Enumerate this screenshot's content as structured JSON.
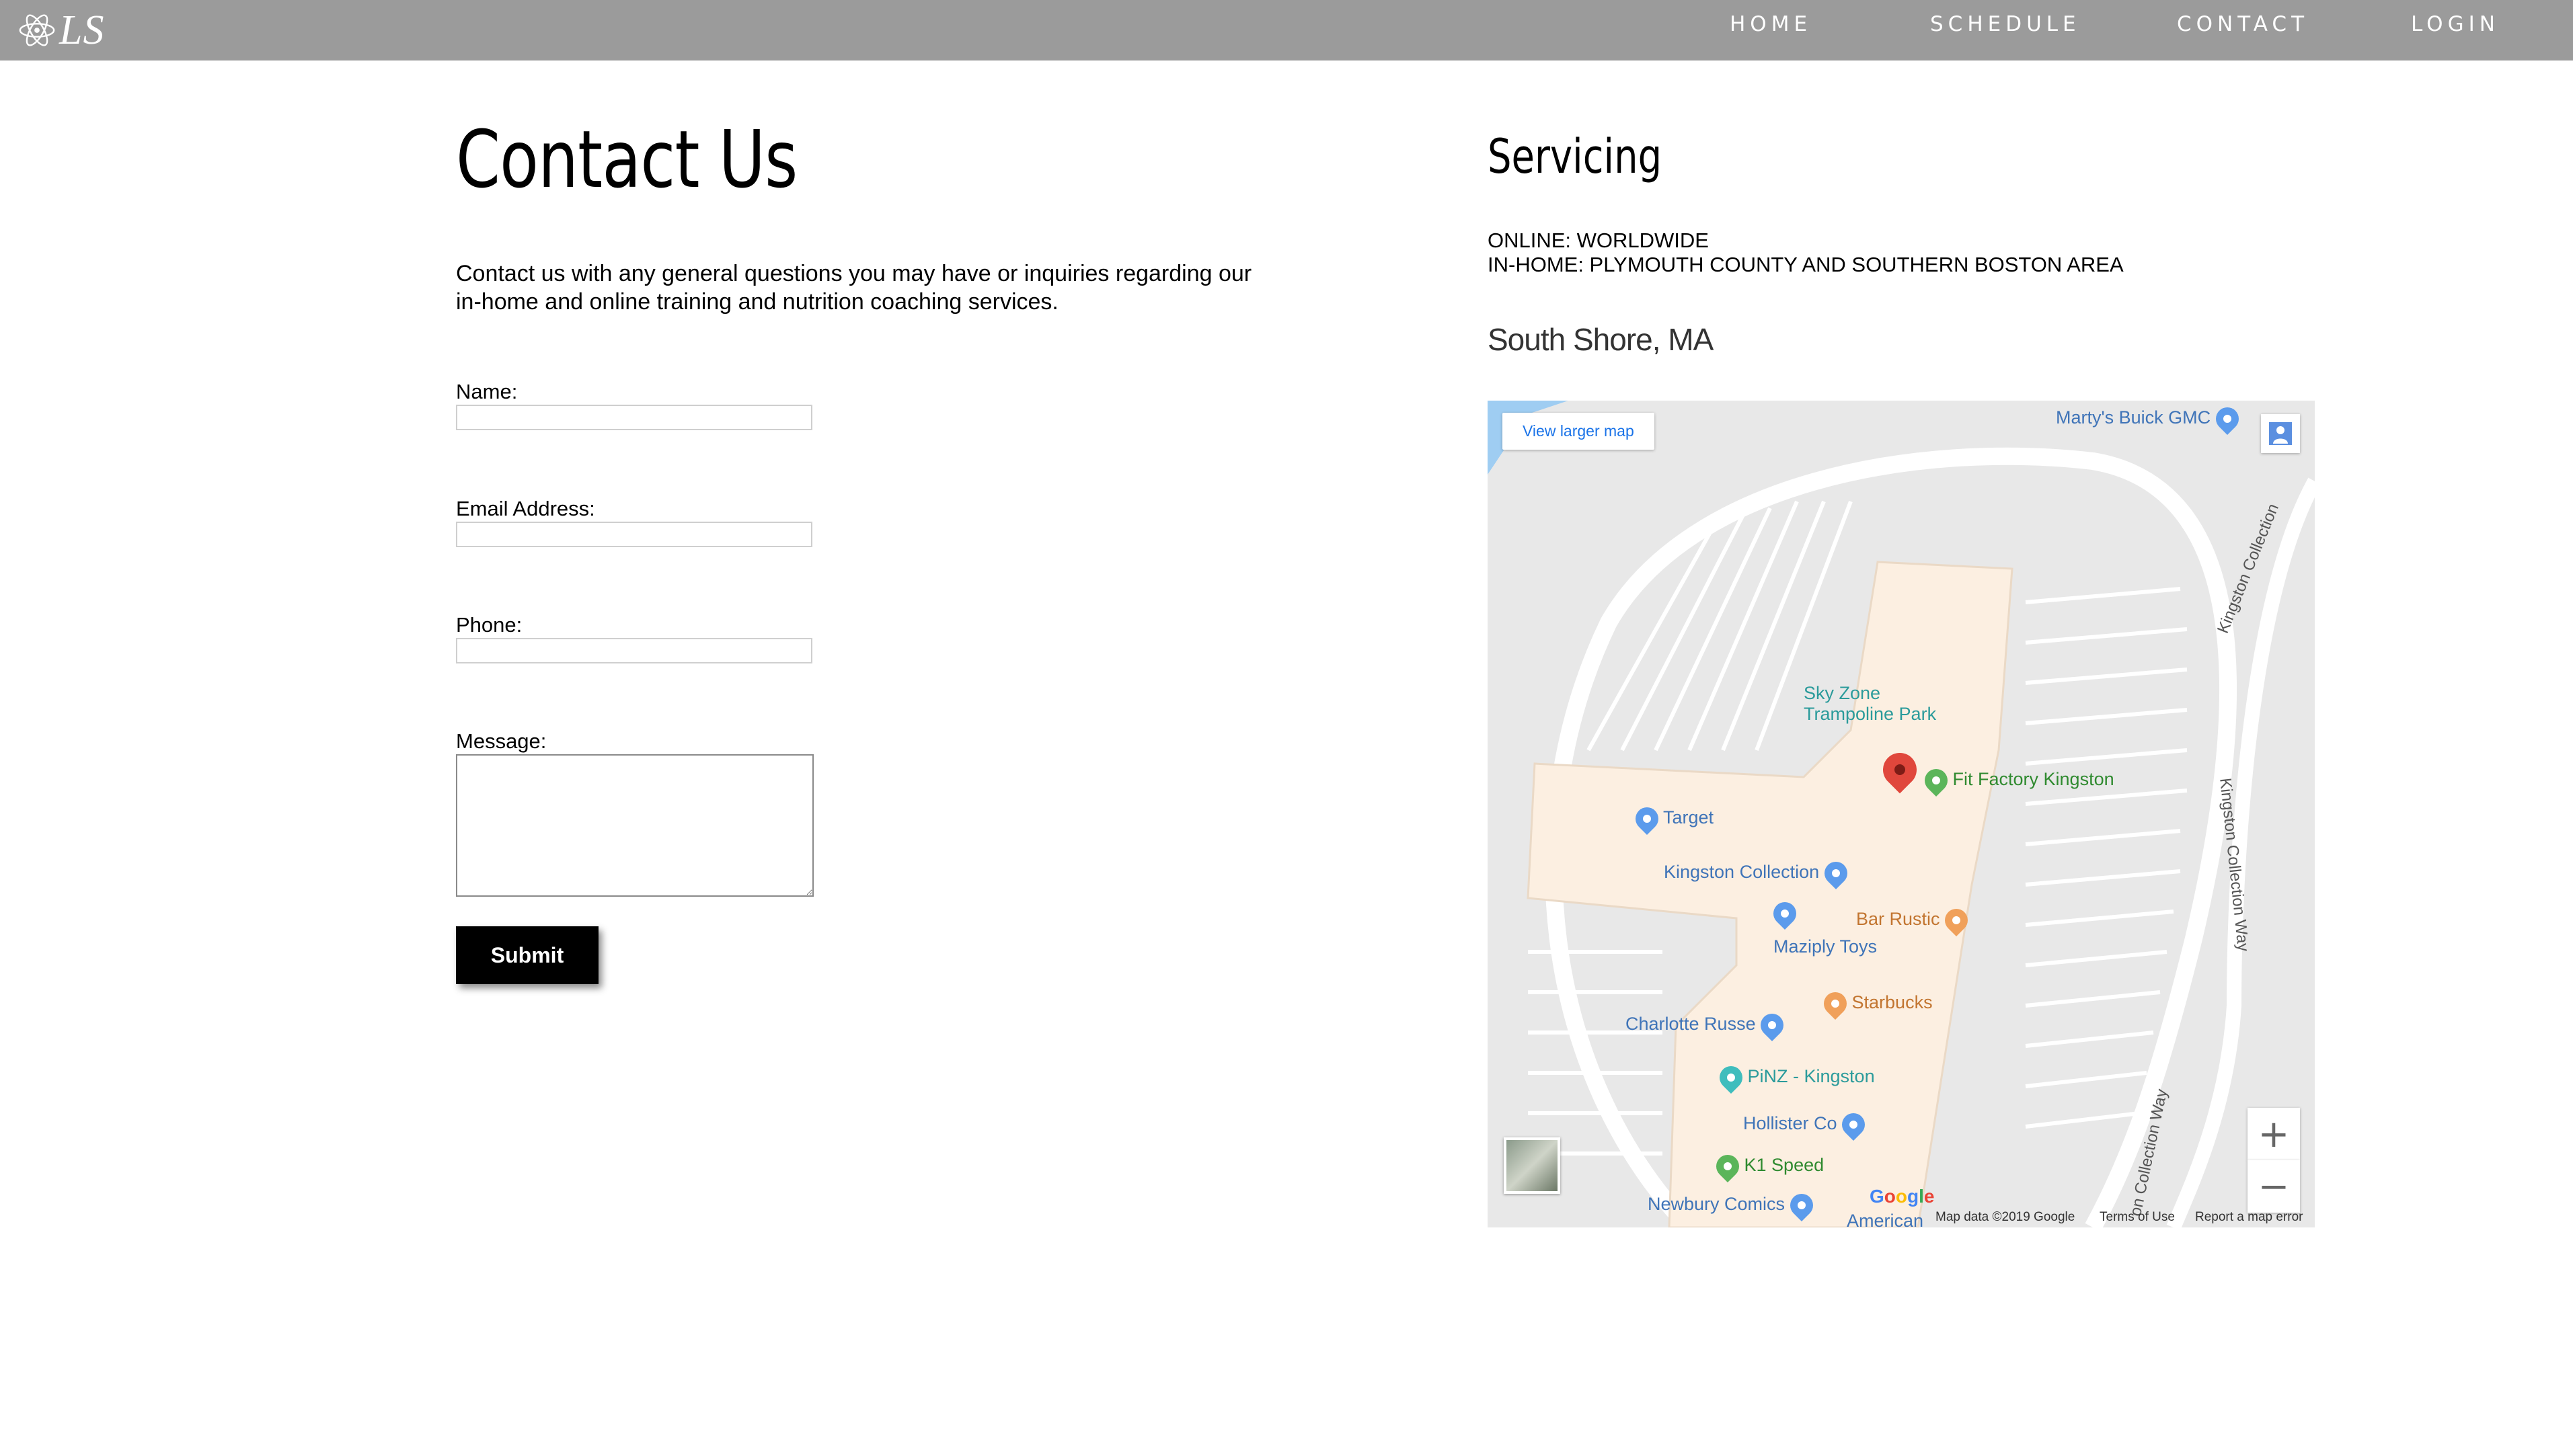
{
  "nav": {
    "logo_text": "LS",
    "links": [
      "HOME",
      "SCHEDULE",
      "CONTACT",
      "LOGIN"
    ]
  },
  "contact": {
    "title": "Contact Us",
    "intro": "Contact us with any general questions you may have or inquiries regarding our in-home and online training and nutrition coaching services.",
    "name_label": "Name:",
    "email_label": "Email Address:",
    "phone_label": "Phone:",
    "message_label": "Message:",
    "submit_label": "Submit"
  },
  "servicing": {
    "title": "Servicing",
    "online": "ONLINE: WORLDWIDE",
    "in_home": "IN-HOME: PLYMOUTH COUNTY AND SOUTHERN BOSTON AREA",
    "region": "South Shore, MA"
  },
  "map": {
    "view_larger": "View larger map",
    "pois": {
      "martys": "Marty's Buick GMC",
      "skyzone_1": "Sky Zone",
      "skyzone_2": "Trampoline Park",
      "fitfactory": "Fit Factory Kingston",
      "target": "Target",
      "kingston_collection": "Kingston Collection",
      "bar_rustic": "Bar Rustic",
      "maziply": "Maziply Toys",
      "starbucks": "Starbucks",
      "charlotte": "Charlotte Russe",
      "pinz": "PiNZ - Kingston",
      "hollister": "Hollister Co",
      "k1speed": "K1 Speed",
      "newbury": "Newbury Comics",
      "american": "American"
    },
    "roads": {
      "kingston_collection_road": "Kingston Collection",
      "kingston_collection_way": "Kingston Collection Way",
      "on_collection_way": "on Collection Way"
    },
    "zoom_in": "+",
    "zoom_out": "−",
    "google": "Google",
    "map_data": "Map data ©2019 Google",
    "terms": "Terms of Use",
    "report": "Report a map error"
  },
  "colors": {
    "nav_bg": "#9b9b9b",
    "map_pin": "#e0473c",
    "poi_blue": "#5b9bec",
    "poi_green": "#5bb55a",
    "poi_orange": "#f0a05a",
    "poi_teal": "#3fbdbd"
  },
  "icons": [
    "atom-logo-icon",
    "map-pin-icon",
    "pegman-icon",
    "zoom-in-icon",
    "zoom-out-icon"
  ]
}
